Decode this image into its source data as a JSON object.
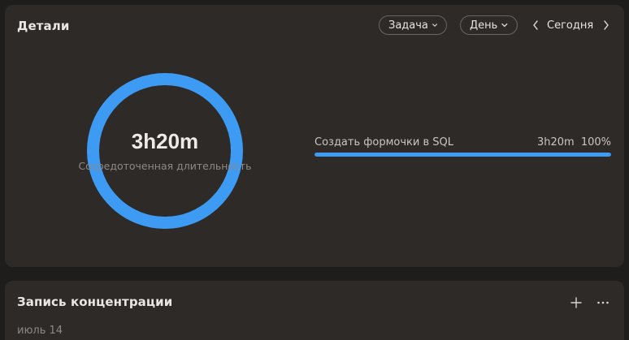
{
  "details": {
    "title": "Детали",
    "filter_task": "Задача",
    "filter_period": "День",
    "date_label": "Сегодня",
    "total_duration": "3h20m",
    "total_label": "Сосредоточенная длительность",
    "ring_progress": 1.0,
    "tasks": [
      {
        "name": "Создать формочки в SQL",
        "duration": "3h20m",
        "percent_label": "100%",
        "percent": 100
      }
    ]
  },
  "record": {
    "title": "Запись концентрации",
    "date": "июль 14"
  },
  "colors": {
    "accent": "#3d9bf4",
    "card": "#2d2a28",
    "background": "#1f1d1c"
  },
  "icons": {
    "filter_chevron": "chevron-down-icon",
    "prev": "chevron-left-icon",
    "next": "chevron-right-icon",
    "add": "plus-icon",
    "more": "more-horizontal-icon"
  }
}
